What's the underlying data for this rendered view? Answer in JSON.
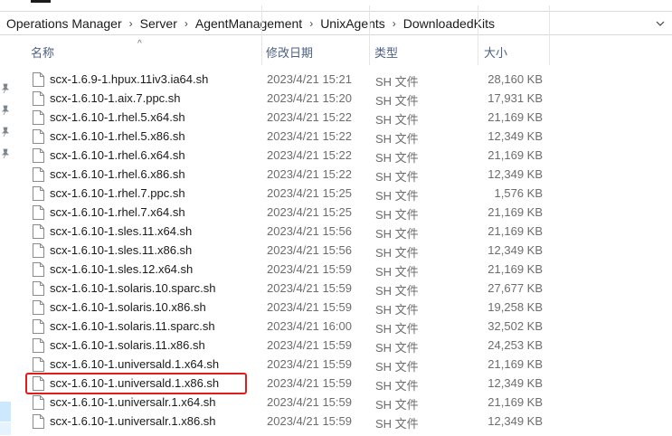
{
  "breadcrumbs": [
    "Operations Manager",
    "Server",
    "AgentManagement",
    "UnixAgents",
    "DownloadedKits"
  ],
  "breadcrumb_separator": "›",
  "columns": {
    "name": "名称",
    "date": "修改日期",
    "type": "类型",
    "size": "大小"
  },
  "sort_indicator": "^",
  "files": [
    {
      "name": "scx-1.6.9-1.hpux.11iv3.ia64.sh",
      "date": "2023/4/21 15:21",
      "type": "SH 文件",
      "size": "28,160 KB"
    },
    {
      "name": "scx-1.6.10-1.aix.7.ppc.sh",
      "date": "2023/4/21 15:20",
      "type": "SH 文件",
      "size": "17,931 KB"
    },
    {
      "name": "scx-1.6.10-1.rhel.5.x64.sh",
      "date": "2023/4/21 15:22",
      "type": "SH 文件",
      "size": "21,169 KB"
    },
    {
      "name": "scx-1.6.10-1.rhel.5.x86.sh",
      "date": "2023/4/21 15:22",
      "type": "SH 文件",
      "size": "12,349 KB"
    },
    {
      "name": "scx-1.6.10-1.rhel.6.x64.sh",
      "date": "2023/4/21 15:22",
      "type": "SH 文件",
      "size": "21,169 KB"
    },
    {
      "name": "scx-1.6.10-1.rhel.6.x86.sh",
      "date": "2023/4/21 15:22",
      "type": "SH 文件",
      "size": "12,349 KB"
    },
    {
      "name": "scx-1.6.10-1.rhel.7.ppc.sh",
      "date": "2023/4/21 15:25",
      "type": "SH 文件",
      "size": "1,576 KB"
    },
    {
      "name": "scx-1.6.10-1.rhel.7.x64.sh",
      "date": "2023/4/21 15:25",
      "type": "SH 文件",
      "size": "21,169 KB"
    },
    {
      "name": "scx-1.6.10-1.sles.11.x64.sh",
      "date": "2023/4/21 15:56",
      "type": "SH 文件",
      "size": "21,169 KB"
    },
    {
      "name": "scx-1.6.10-1.sles.11.x86.sh",
      "date": "2023/4/21 15:56",
      "type": "SH 文件",
      "size": "12,349 KB"
    },
    {
      "name": "scx-1.6.10-1.sles.12.x64.sh",
      "date": "2023/4/21 15:59",
      "type": "SH 文件",
      "size": "21,169 KB"
    },
    {
      "name": "scx-1.6.10-1.solaris.10.sparc.sh",
      "date": "2023/4/21 15:59",
      "type": "SH 文件",
      "size": "27,677 KB"
    },
    {
      "name": "scx-1.6.10-1.solaris.10.x86.sh",
      "date": "2023/4/21 15:59",
      "type": "SH 文件",
      "size": "19,258 KB"
    },
    {
      "name": "scx-1.6.10-1.solaris.11.sparc.sh",
      "date": "2023/4/21 16:00",
      "type": "SH 文件",
      "size": "32,502 KB"
    },
    {
      "name": "scx-1.6.10-1.solaris.11.x86.sh",
      "date": "2023/4/21 15:59",
      "type": "SH 文件",
      "size": "24,253 KB"
    },
    {
      "name": "scx-1.6.10-1.universald.1.x64.sh",
      "date": "2023/4/21 15:59",
      "type": "SH 文件",
      "size": "21,169 KB"
    },
    {
      "name": "scx-1.6.10-1.universald.1.x86.sh",
      "date": "2023/4/21 15:59",
      "type": "SH 文件",
      "size": "12,349 KB",
      "highlighted": true
    },
    {
      "name": "scx-1.6.10-1.universalr.1.x64.sh",
      "date": "2023/4/21 15:59",
      "type": "SH 文件",
      "size": "21,169 KB"
    },
    {
      "name": "scx-1.6.10-1.universalr.1.x86.sh",
      "date": "2023/4/21 15:59",
      "type": "SH 文件",
      "size": "12,349 KB"
    }
  ],
  "colors": {
    "highlight_border": "#e01d1d",
    "header_text": "#4d6082",
    "muted_text": "#6d6d6d"
  },
  "icons": {
    "file": "document-icon",
    "pin": "pin-icon",
    "address_dropdown": "chevron-down-icon"
  }
}
